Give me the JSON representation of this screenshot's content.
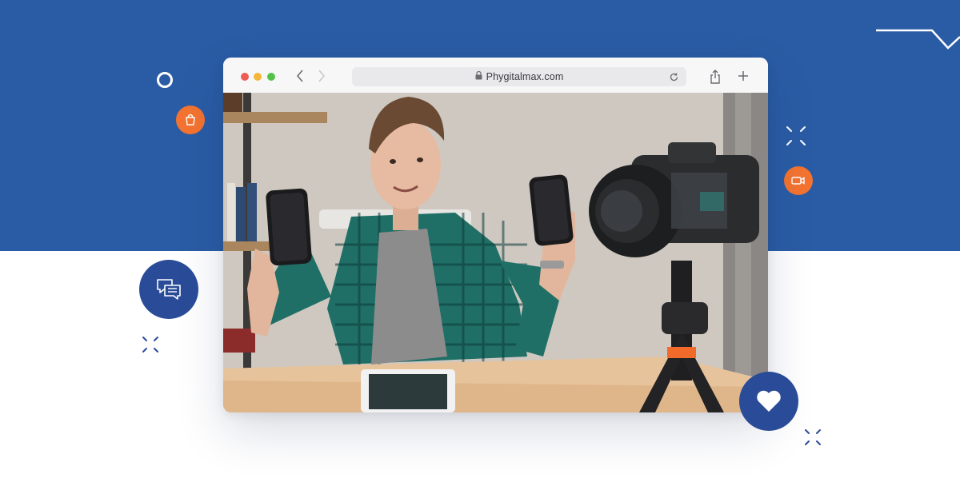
{
  "browser": {
    "url": "Phygitalmax.com",
    "controls": {
      "back": "chevron-left-icon",
      "forward": "chevron-right-icon",
      "reload": "reload-icon",
      "share": "share-icon",
      "new_tab": "plus-icon",
      "lock": "lock-icon"
    }
  },
  "scene": {
    "content": "photo"
  },
  "decorations": {
    "icons": [
      "ring",
      "shopping-bag-icon",
      "video-camera-icon",
      "chat-icon",
      "heart-icon",
      "sparkle-icon"
    ]
  },
  "colors": {
    "band": "#2a5ca5",
    "navy": "#2a4c98",
    "orange": "#f47330",
    "background": "#ffffff"
  }
}
